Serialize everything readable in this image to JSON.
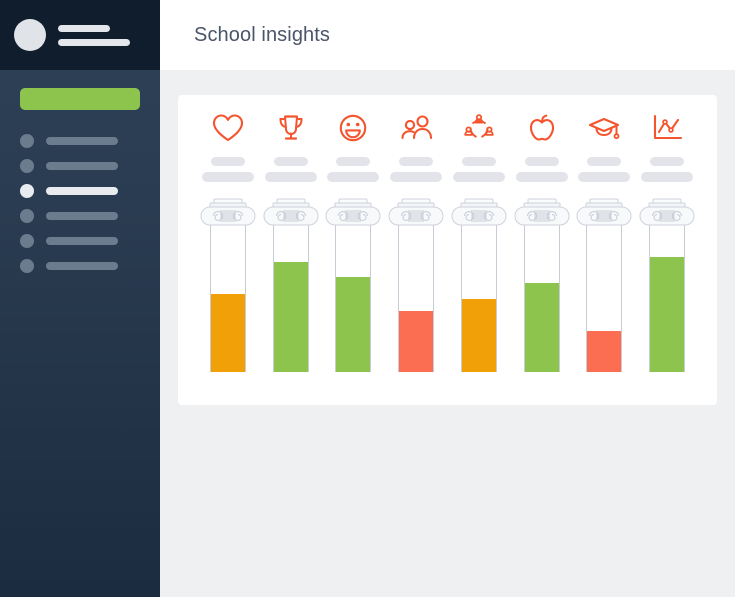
{
  "header": {
    "title": "School insights"
  },
  "sidebar": {
    "avatar": {
      "icon": "avatar-circle"
    },
    "profile_lines": [
      "",
      ""
    ],
    "cta_button": {
      "label": "",
      "color": "#8cc44e"
    },
    "items": [
      {
        "label": "",
        "icon": "circle-icon",
        "active": false
      },
      {
        "label": "",
        "icon": "circle-icon",
        "active": false
      },
      {
        "label": "",
        "icon": "circle-icon",
        "active": true
      },
      {
        "label": "",
        "icon": "circle-icon",
        "active": false
      },
      {
        "label": "",
        "icon": "circle-icon",
        "active": false
      },
      {
        "label": "",
        "icon": "circle-icon",
        "active": false
      }
    ]
  },
  "colors": {
    "sidebar_header": "#101d2d",
    "sidebar_top": "#2e4157",
    "sidebar_bottom": "#1b2c40",
    "page_background": "#eef0f2",
    "card_background": "#ffffff",
    "accent_orange_red": "#f4552f",
    "green": "#8cc44e",
    "amber": "#f2a007",
    "coral": "#fc6e51",
    "placeholder_grey": "#e2e4e9",
    "title_text": "#4a5568"
  },
  "chart_data": {
    "type": "bar",
    "title": "School insights",
    "xlabel": "",
    "ylabel": "",
    "ylim": [
      0,
      100
    ],
    "grid": false,
    "legend": "none",
    "categories": [
      "wellbeing",
      "achievement",
      "happiness",
      "community",
      "teamwork",
      "nutrition",
      "graduation",
      "performance"
    ],
    "values": [
      53,
      74,
      64,
      41,
      49,
      60,
      28,
      78
    ],
    "bar_colors": [
      "#f2a007",
      "#8cc44e",
      "#8cc44e",
      "#fc6e51",
      "#f2a007",
      "#8cc44e",
      "#fc6e51",
      "#8cc44e"
    ],
    "status": [
      "warning",
      "good",
      "good",
      "poor",
      "warning",
      "good",
      "poor",
      "good"
    ]
  },
  "metrics": [
    {
      "icon": "heart-icon",
      "label": "",
      "sub_label": ""
    },
    {
      "icon": "trophy-icon",
      "label": "",
      "sub_label": ""
    },
    {
      "icon": "smiley-face-icon",
      "label": "",
      "sub_label": ""
    },
    {
      "icon": "people-icon",
      "label": "",
      "sub_label": ""
    },
    {
      "icon": "teamwork-icon",
      "label": "",
      "sub_label": ""
    },
    {
      "icon": "apple-icon",
      "label": "",
      "sub_label": ""
    },
    {
      "icon": "graduation-cap-icon",
      "label": "",
      "sub_label": ""
    },
    {
      "icon": "line-chart-icon",
      "label": "",
      "sub_label": ""
    }
  ]
}
